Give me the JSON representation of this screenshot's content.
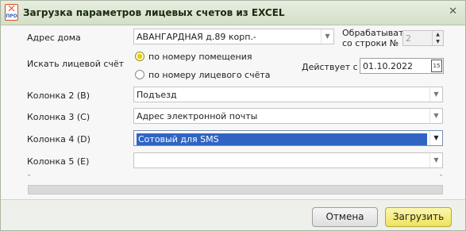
{
  "window": {
    "title": "Загрузка параметров лицевых счетов из EXCEL",
    "close_glyph": "✕"
  },
  "app_icon": {
    "text": "ПРО"
  },
  "form": {
    "address_label": "Адрес дома",
    "address_value": "АВАНГАРДНАЯ д.89 корп.-",
    "start_row_label_1": "Обрабатывать",
    "start_row_label_2": "со строки №",
    "start_row_value": "2",
    "search_label": "Искать лицевой счёт",
    "radio_by_room": "по номеру помещения",
    "radio_by_account": "по номеру лицевого счёта",
    "effective_label": "Действует с",
    "effective_date": "01.10.2022",
    "calendar_glyph": "15",
    "col2_label": "Колонка 2 (B)",
    "col2_value": "Подъезд",
    "col3_label": "Колонка 3 (C)",
    "col3_value": "Адрес электронной почты",
    "col4_label": "Колонка 4 (D)",
    "col4_value": "Сотовый для SMS",
    "col5_label": "Колонка 5 (E)",
    "col5_value": ""
  },
  "progress": {
    "value_percent": 0,
    "left_mark": "-",
    "right_mark": "-"
  },
  "buttons": {
    "cancel": "Отмена",
    "load": "Загрузить"
  },
  "colors": {
    "selection": "#2f64c3",
    "load_button": "#eee35a",
    "radio_on": "#e7d200"
  }
}
